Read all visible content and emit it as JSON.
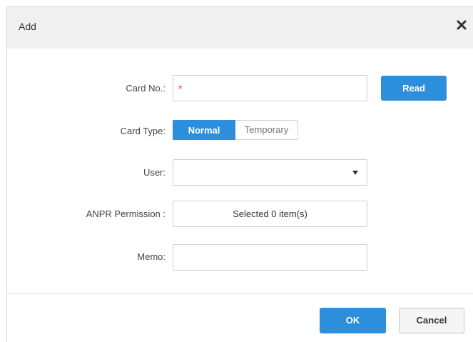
{
  "dialog": {
    "title": "Add",
    "close_icon": "close-icon"
  },
  "form": {
    "card_no": {
      "label": "Card No.:",
      "value": "",
      "required_mark": "*"
    },
    "read_button": "Read",
    "card_type": {
      "label": "Card Type:",
      "options": [
        "Normal",
        "Temporary"
      ],
      "selected": "Normal"
    },
    "user": {
      "label": "User:",
      "value": ""
    },
    "anpr_permission": {
      "label": "ANPR Permission :",
      "value": "Selected 0 item(s)"
    },
    "memo": {
      "label": "Memo:",
      "value": ""
    }
  },
  "footer": {
    "ok_label": "OK",
    "cancel_label": "Cancel"
  },
  "colors": {
    "accent": "#2d8fdb",
    "required": "#e53935",
    "header_bg": "#f0f0f0"
  }
}
